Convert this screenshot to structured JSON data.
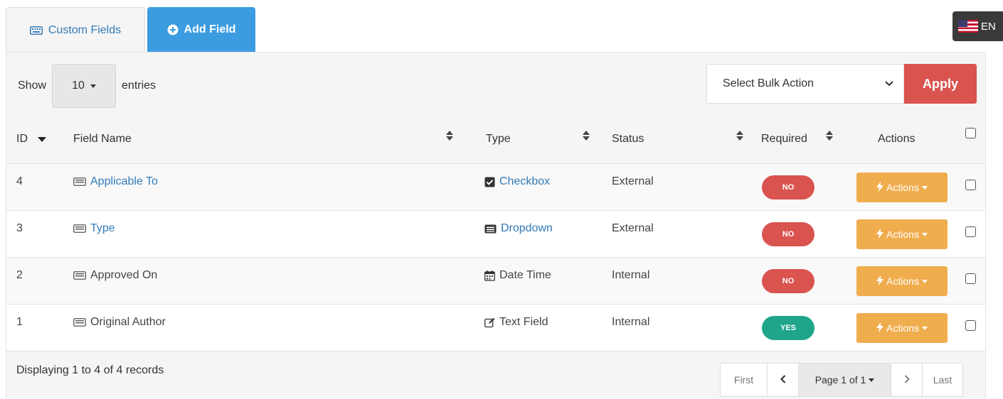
{
  "tabs": [
    {
      "label": "Custom Fields",
      "icon": "keyboard-icon"
    },
    {
      "label": "Add Field",
      "icon": "plus-circle-icon"
    }
  ],
  "language": {
    "label": "EN",
    "icon": "us-flag-icon"
  },
  "toolbar": {
    "show_label": "Show",
    "entries_value": "10",
    "entries_label": "entries",
    "bulk_action_value": "Select Bulk Action",
    "apply_label": "Apply"
  },
  "table": {
    "headers": {
      "id": "ID",
      "field_name": "Field Name",
      "type": "Type",
      "status": "Status",
      "required": "Required",
      "actions": "Actions"
    },
    "rows": [
      {
        "id": "4",
        "name": "Applicable To",
        "type": "Checkbox",
        "type_icon": "checkbox-icon",
        "status": "External",
        "required": "NO",
        "action_label": "Actions"
      },
      {
        "id": "3",
        "name": "Type",
        "type": "Dropdown",
        "type_icon": "dropdown-icon",
        "status": "External",
        "required": "NO",
        "action_label": "Actions"
      },
      {
        "id": "2",
        "name": "Approved On",
        "type": "Date Time",
        "type_icon": "calendar-icon",
        "status": "Internal",
        "required": "NO",
        "action_label": "Actions"
      },
      {
        "id": "1",
        "name": "Original Author",
        "type": "Text Field",
        "type_icon": "edit-icon",
        "status": "Internal",
        "required": "YES",
        "action_label": "Actions"
      }
    ]
  },
  "footer": {
    "summary": "Displaying 1 to 4 of 4 records",
    "pager": {
      "first": "First",
      "page": "Page 1 of 1",
      "last": "Last"
    }
  },
  "colors": {
    "primary": "#3c9ce0",
    "link": "#337ab7",
    "danger": "#d9534f",
    "success": "#1fa58a",
    "warning": "#f0ad4e"
  }
}
